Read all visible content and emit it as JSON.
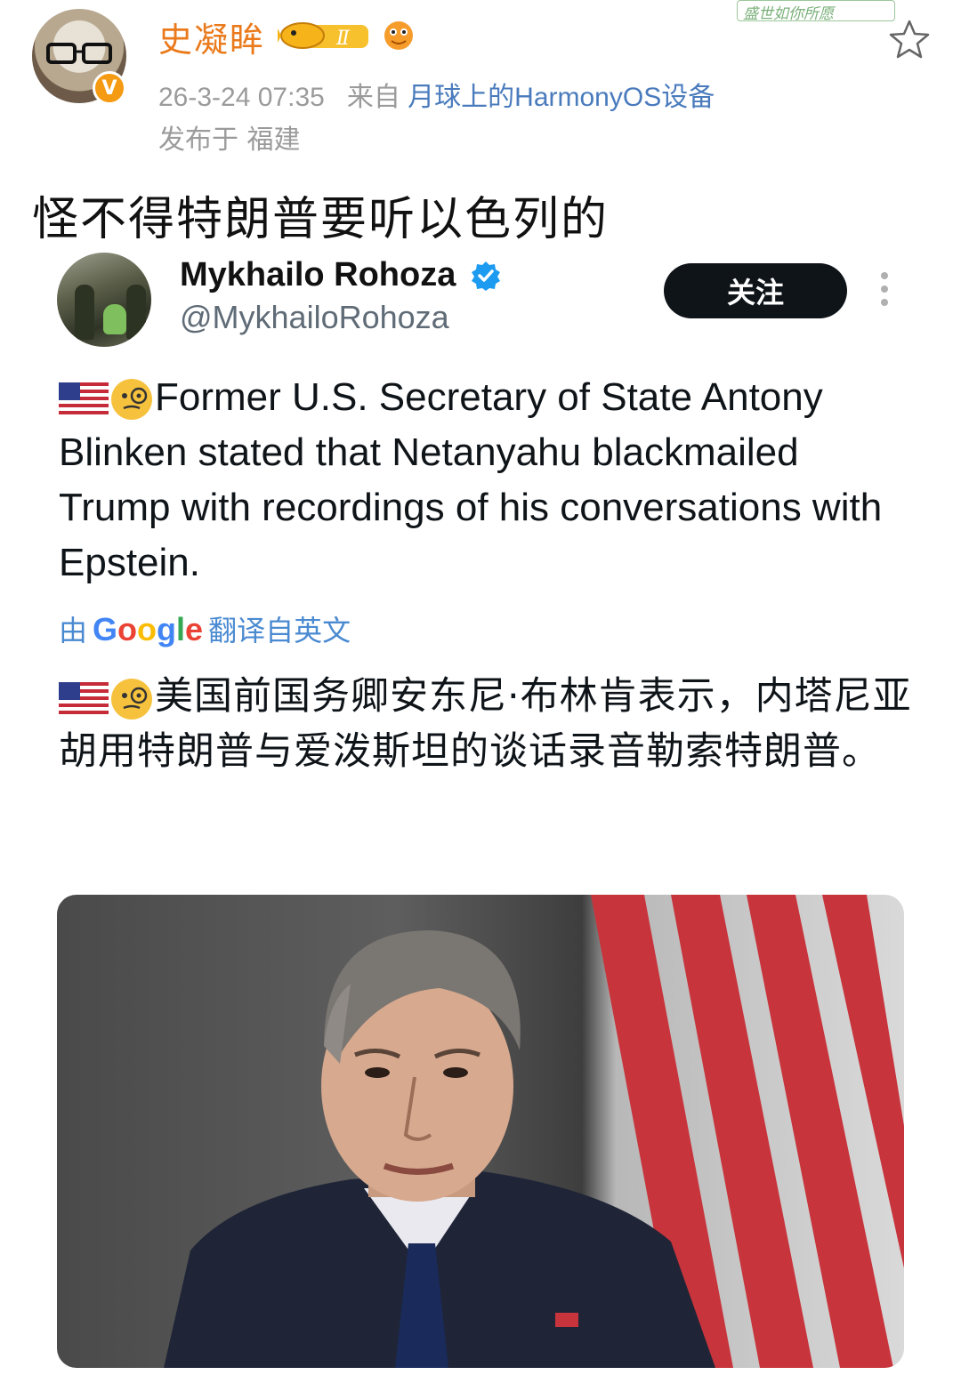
{
  "weibo": {
    "username": "史凝眸",
    "timestamp": "26-3-24 07:35",
    "source_prefix": "来自",
    "source_device": "月球上的HarmonyOS设备",
    "location": "发布于 福建",
    "verified_badge": "V",
    "level_badge": "Ⅱ",
    "sticker_text": "盛世如你所愿",
    "post_text": "怪不得特朗普要听以色列的",
    "favorite_icon": "star-outline-icon"
  },
  "tweet": {
    "author_name": "Mykhailo Rohoza",
    "author_handle": "@MykhailoRohoza",
    "follow_label": "关注",
    "body_en": "Former U.S. Secretary of State Antony Blinken stated that Netanyahu blackmailed Trump with recordings of his conversations with Epstein.",
    "translate_prefix": "由",
    "translate_brand": "Google",
    "translate_suffix": "翻译自英文",
    "body_zh": "美国前国务卿安东尼·布林肯表示，内塔尼亚胡用特朗普与爱泼斯坦的谈话录音勒索特朗普。",
    "emoji": [
      "us-flag-icon",
      "face-with-monocle-icon"
    ]
  },
  "colors": {
    "username": "#ea7a1c",
    "link": "#4a7bbd",
    "translate": "#4a8ad1",
    "follow_bg": "#0f1419",
    "verified": "#1d9bf0"
  }
}
